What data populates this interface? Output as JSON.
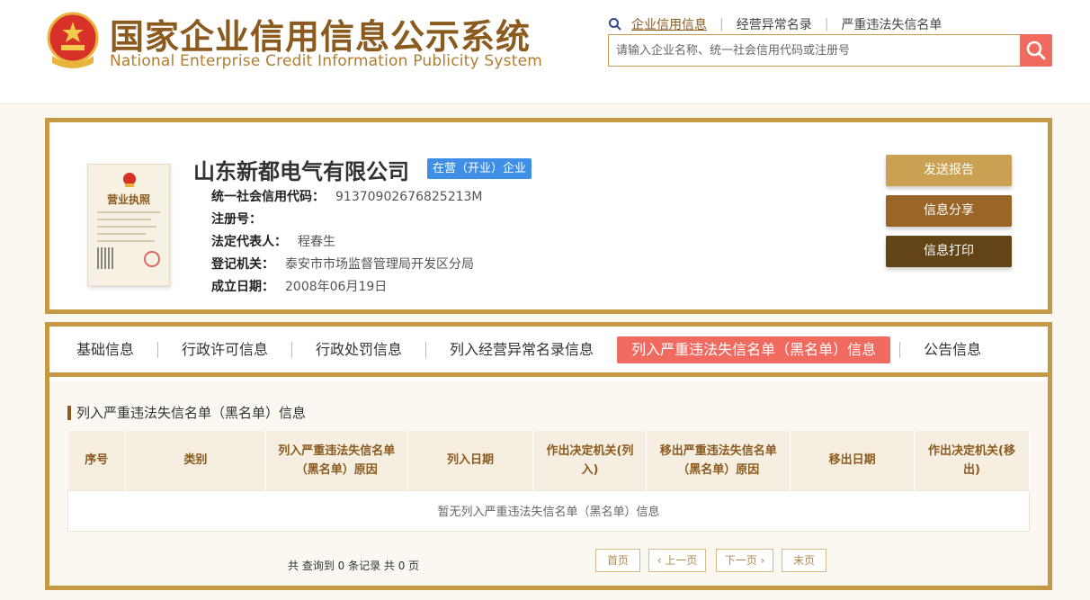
{
  "header": {
    "title_cn": "国家企业信用信息公示系统",
    "title_en": "National Enterprise Credit Information Publicity System",
    "nav_links": [
      "企业信用信息",
      "经营异常名录",
      "严重违法失信名单"
    ],
    "search_placeholder": "请输入企业名称、统一社会信用代码或注册号",
    "icons": {
      "search": "search-icon",
      "emblem": "national-emblem-icon"
    }
  },
  "company": {
    "name": "山东新都电气有限公司",
    "status": "在营（开业）企业",
    "license_title": "营业执照",
    "fields": [
      {
        "label": "统一社会信用代码：",
        "value": "91370902676825213M"
      },
      {
        "label": "注册号：",
        "value": ""
      },
      {
        "label": "法定代表人：",
        "value": "程春生"
      },
      {
        "label": "登记机关：",
        "value": "泰安市市场监督管理局开发区分局"
      },
      {
        "label": "成立日期：",
        "value": "2008年06月19日"
      }
    ],
    "actions": {
      "send": "发送报告",
      "share": "信息分享",
      "print": "信息打印"
    }
  },
  "tabs": [
    "基础信息",
    "行政许可信息",
    "行政处罚信息",
    "列入经营异常名录信息",
    "列入严重违法失信名单（黑名单）信息",
    "公告信息"
  ],
  "active_tab": "列入严重违法失信名单（黑名单）信息",
  "section": {
    "title": "列入严重违法失信名单（黑名单）信息",
    "table_headers": [
      "序号",
      "类别",
      "列入严重违法失信名单（黑名单）原因",
      "列入日期",
      "作出决定机关(列入)",
      "移出严重违法失信名单（黑名单）原因",
      "移出日期",
      "作出决定机关(移出)"
    ],
    "empty_text": "暂无列入严重违法失信名单（黑名单）信息"
  },
  "pagination": {
    "summary": "共 查询到 0 条记录 共 0 页",
    "first": "首页",
    "prev": "‹ 上一页",
    "next": "下一页 ›",
    "last": "末页"
  },
  "colors": {
    "brand_brown": "#8a5a1e",
    "gold_border": "#c69a45",
    "accent_red": "#f06a5f",
    "status_blue": "#3f8fe6"
  }
}
